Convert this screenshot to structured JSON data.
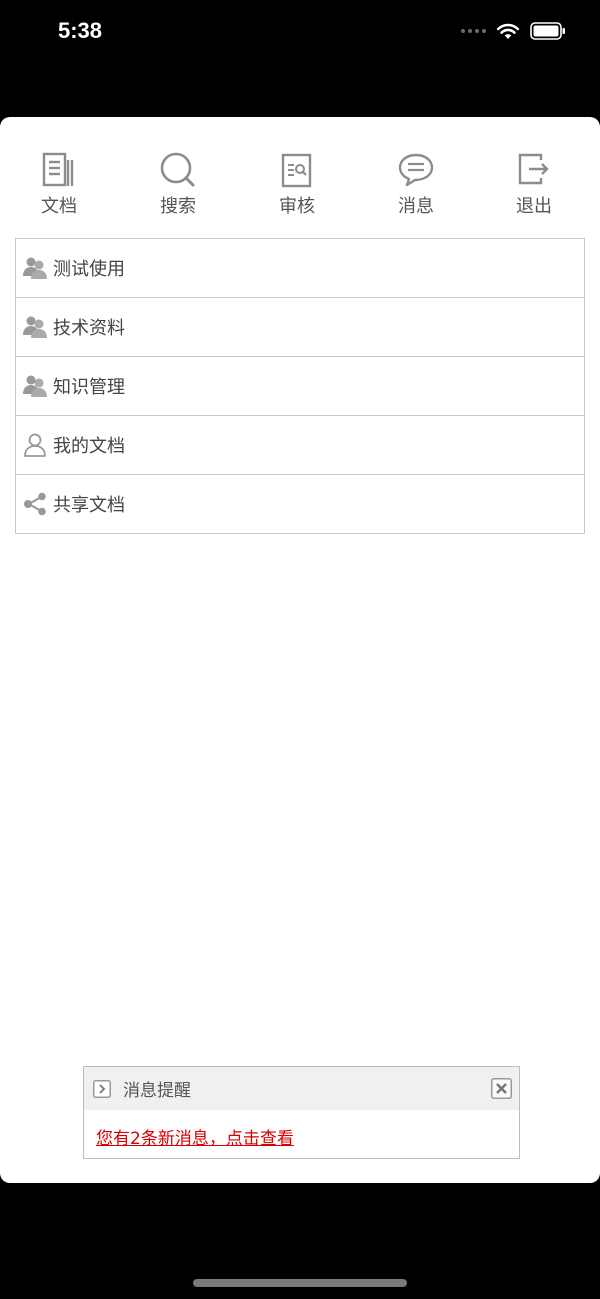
{
  "status_bar": {
    "time": "5:38",
    "signal_icon": "cellular-signal-icon",
    "wifi_icon": "wifi-icon",
    "battery_icon": "battery-icon"
  },
  "nav": {
    "items": [
      {
        "label": "文档",
        "icon": "document-icon"
      },
      {
        "label": "搜索",
        "icon": "search-icon"
      },
      {
        "label": "审核",
        "icon": "review-icon"
      },
      {
        "label": "消息",
        "icon": "message-icon"
      },
      {
        "label": "退出",
        "icon": "logout-icon"
      }
    ]
  },
  "folders": {
    "items": [
      {
        "label": "测试使用",
        "icon": "group-icon"
      },
      {
        "label": "技术资料",
        "icon": "group-icon"
      },
      {
        "label": "知识管理",
        "icon": "group-icon"
      },
      {
        "label": "我的文档",
        "icon": "user-icon"
      },
      {
        "label": "共享文档",
        "icon": "share-icon"
      }
    ]
  },
  "message_popup": {
    "title": "消息提醒",
    "link_text": "您有2条新消息，点击查看",
    "link_color": "#d90000"
  }
}
